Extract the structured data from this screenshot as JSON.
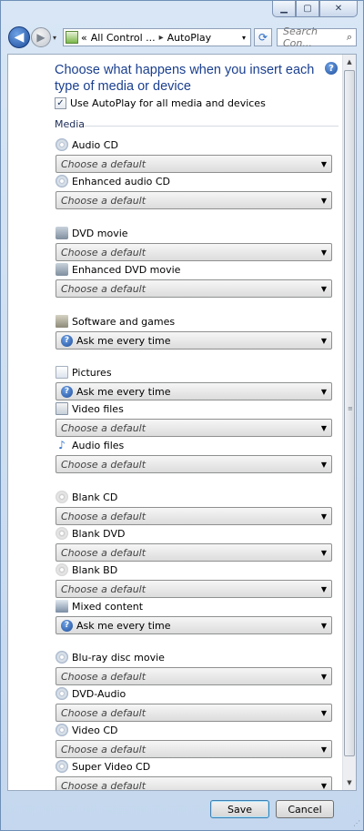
{
  "window": {
    "minimize_icon": "minimize-icon",
    "maximize_icon": "maximize-icon",
    "close_icon": "close-icon",
    "min_glyph": "▁",
    "max_glyph": "▢",
    "close_glyph": "✕"
  },
  "nav": {
    "back_glyph": "◀",
    "forward_glyph": "▶",
    "history_glyph": "▾",
    "breadcrumb_prefix": "«",
    "breadcrumb_parent": "All Control ...",
    "breadcrumb_sep": "▸",
    "breadcrumb_current": "AutoPlay",
    "address_dropdown_glyph": "▾",
    "refresh_glyph": "⟳",
    "search_placeholder": "Search Con...",
    "search_glyph": "⌕"
  },
  "page": {
    "title": "Choose what happens when you insert each type of media or device",
    "help_glyph": "?",
    "use_autoplay_label": "Use AutoPlay for all media and devices",
    "use_autoplay_checked": true,
    "check_glyph": "✓",
    "media_section": "Media"
  },
  "items": [
    {
      "label": "Audio CD",
      "value": "Choose a default",
      "icon": "cd-icon",
      "ask": false
    },
    {
      "label": "Enhanced audio CD",
      "value": "Choose a default",
      "icon": "cd-icon",
      "ask": false
    },
    {
      "label": "DVD movie",
      "value": "Choose a default",
      "icon": "dvd-icon",
      "ask": false
    },
    {
      "label": "Enhanced DVD movie",
      "value": "Choose a default",
      "icon": "dvd-icon",
      "ask": false
    },
    {
      "label": "Software and games",
      "value": "Ask me every time",
      "icon": "software-icon",
      "ask": true
    },
    {
      "label": "Pictures",
      "value": "Ask me every time",
      "icon": "pictures-icon",
      "ask": true
    },
    {
      "label": "Video files",
      "value": "Choose a default",
      "icon": "video-files-icon",
      "ask": false
    },
    {
      "label": "Audio files",
      "value": "Choose a default",
      "icon": "audio-files-icon",
      "ask": false
    },
    {
      "label": "Blank CD",
      "value": "Choose a default",
      "icon": "blank-disc-icon",
      "ask": false
    },
    {
      "label": "Blank DVD",
      "value": "Choose a default",
      "icon": "blank-disc-icon",
      "ask": false
    },
    {
      "label": "Blank BD",
      "value": "Choose a default",
      "icon": "blank-disc-icon",
      "ask": false
    },
    {
      "label": "Mixed content",
      "value": "Ask me every time",
      "icon": "mixed-content-icon",
      "ask": true
    },
    {
      "label": "Blu-ray disc movie",
      "value": "Choose a default",
      "icon": "disc-icon",
      "ask": false
    },
    {
      "label": "DVD-Audio",
      "value": "Choose a default",
      "icon": "disc-icon",
      "ask": false
    },
    {
      "label": "Video CD",
      "value": "Choose a default",
      "icon": "disc-icon",
      "ask": false
    },
    {
      "label": "Super Video CD",
      "value": "Choose a default",
      "icon": "disc-icon",
      "ask": false
    }
  ],
  "dropdown_glyph": "▼",
  "ask_glyph": "?",
  "audio_note_glyph": "♪",
  "buttons": {
    "save": "Save",
    "cancel": "Cancel"
  },
  "scroll_glyphs": {
    "up": "▲",
    "down": "▼",
    "grip": "≡",
    "resize_grip": "⋰"
  }
}
